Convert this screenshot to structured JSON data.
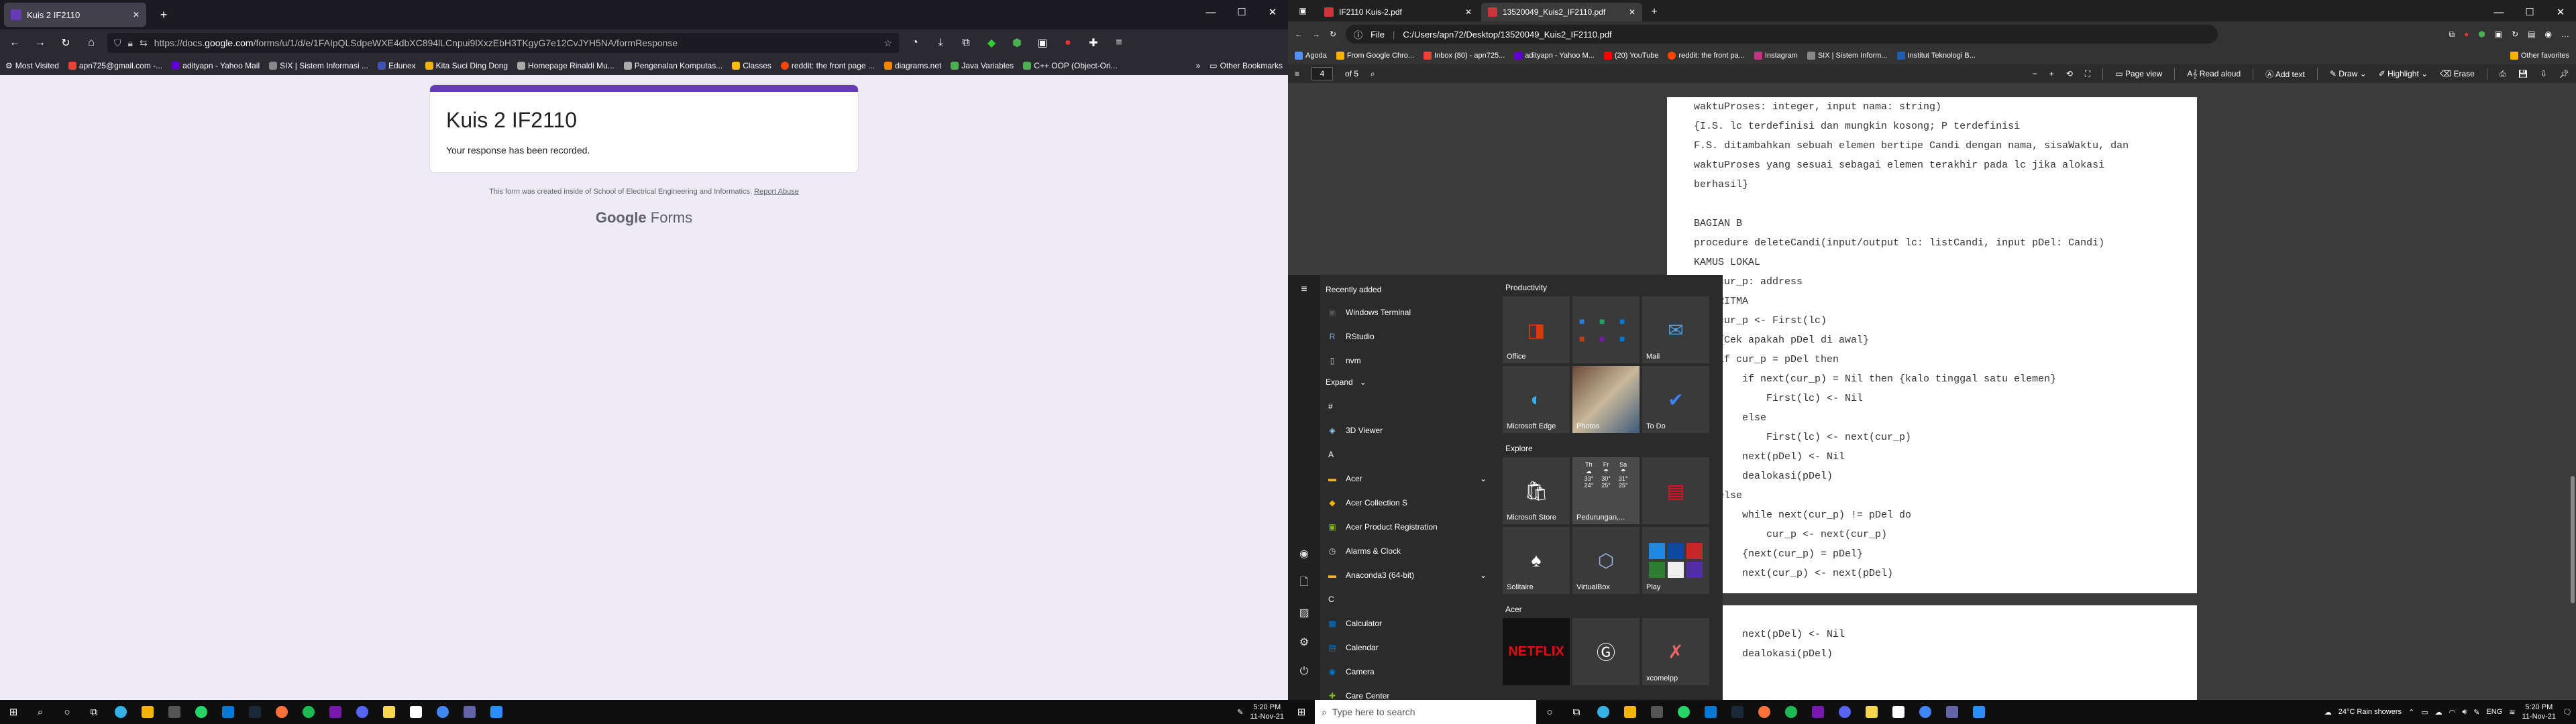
{
  "firefox": {
    "tab_title": "Kuis 2 IF2110",
    "url_prefix": "https://docs.",
    "url_domain": "google.com",
    "url_rest": "/forms/u/1/d/e/1FAIpQLSdpeWXE4dbXC894lLCnpui9lXxzEbH3TKgyG7e12CvJYH5NA/formResponse",
    "bookmarks": [
      "Most Visited",
      "apn725@gmail.com -...",
      "adityapn - Yahoo Mail",
      "SIX | Sistem Informasi ...",
      "Edunex",
      "Kita Suci Ding Dong",
      "Homepage Rinaldi Mu...",
      "Pengenalan Komputas...",
      "Classes",
      "reddit: the front page ...",
      "diagrams.net",
      "Java Variables",
      "C++ OOP (Object-Ori..."
    ],
    "other_bookmarks": "Other Bookmarks",
    "colors": {
      "accent": "#673ab7",
      "page_bg": "#efeaf7"
    }
  },
  "form": {
    "title": "Kuis 2 IF2110",
    "message": "Your response has been recorded.",
    "footer_text": "This form was created inside of School of Electrical Engineering and Informatics.",
    "footer_link": "Report Abuse",
    "brand_google": "Google",
    "brand_forms": "Forms"
  },
  "edge": {
    "tabs": [
      "IF2110 Kuis-2.pdf",
      "13520049_Kuis2_IF2110.pdf"
    ],
    "file_label": "File",
    "url": "C:/Users/apn72/Desktop/13520049_Kuis2_IF2110.pdf",
    "bookmarks": [
      "Agoda",
      "From Google Chro...",
      "Inbox (80) - apn725...",
      "adityapn - Yahoo M...",
      "(20) YouTube",
      "reddit: the front pa...",
      "Instagram",
      "SIX | Sistem Inform...",
      "Institut Teknologi B..."
    ],
    "other_favorites": "Other favorites"
  },
  "pdf_toolbar": {
    "page_current": "4",
    "page_total": "of 5",
    "page_view": "Page view",
    "read_aloud": "Read aloud",
    "add_text": "Add text",
    "draw": "Draw",
    "highlight": "Highlight",
    "erase": "Erase"
  },
  "pdf": {
    "page1_lines": [
      "waktuProses: integer, input nama: string)",
      "{I.S. lc terdefinisi dan mungkin kosong; P terdefinisi",
      "F.S. ditambahkan sebuah elemen bertipe Candi dengan nama, sisaWaktu, dan",
      "waktuProses yang sesuai sebagai elemen terakhir pada lc jika alokasi",
      "berhasil}",
      "",
      "BAGIAN B",
      "procedure deleteCandi(input/output lc: listCandi, input pDel: Candi)",
      "KAMUS LOKAL",
      "    cur_p: address",
      "ALGORITMA",
      "    cur_p <- First(lc)",
      "    {Cek apakah pDel di awal}",
      "    if cur_p = pDel then",
      "        if next(cur_p) = Nil then {kalo tinggal satu elemen}",
      "            First(lc) <- Nil",
      "        else",
      "            First(lc) <- next(cur_p)",
      "        next(pDel) <- Nil",
      "        dealokasi(pDel)",
      "    else",
      "        while next(cur_p) != pDel do",
      "            cur_p <- next(cur_p)",
      "        {next(cur_p) = pDel}",
      "        next(cur_p) <- next(pDel)"
    ],
    "page2_lines": [
      "",
      "        next(pDel) <- Nil",
      "        dealokasi(pDel)"
    ]
  },
  "start_menu": {
    "recently_added": "Recently added",
    "recent": [
      "Windows Terminal",
      "RStudio",
      "nvm"
    ],
    "expand": "Expand",
    "apps": [
      {
        "type": "letter",
        "text": "#"
      },
      {
        "type": "app",
        "text": "3D Viewer"
      },
      {
        "type": "letter",
        "text": "A"
      },
      {
        "type": "folder",
        "text": "Acer"
      },
      {
        "type": "app",
        "text": "Acer Collection S"
      },
      {
        "type": "app",
        "text": "Acer Product Registration"
      },
      {
        "type": "app",
        "text": "Alarms & Clock"
      },
      {
        "type": "folder",
        "text": "Anaconda3 (64-bit)"
      },
      {
        "type": "letter",
        "text": "C"
      },
      {
        "type": "app",
        "text": "Calculator"
      },
      {
        "type": "app",
        "text": "Calendar"
      },
      {
        "type": "app",
        "text": "Camera"
      },
      {
        "type": "app",
        "text": "Care Center"
      }
    ],
    "sections": {
      "productivity": "Productivity",
      "explore": "Explore",
      "acer": "Acer"
    },
    "tiles": {
      "office": "Office",
      "mail": "Mail",
      "edge": "Microsoft Edge",
      "photos": "Photos",
      "todo": "To Do",
      "store": "Microsoft Store",
      "weather_city": "Pedurungan,...",
      "weather_days": [
        "Th",
        "Fr",
        "Sa"
      ],
      "weather_hi": [
        "33°",
        "30°",
        "31°"
      ],
      "weather_lo": [
        "24°",
        "25°",
        "25°"
      ],
      "solitaire": "Solitaire",
      "virtualbox": "VirtualBox",
      "play": "Play",
      "netflix": "NETFLIX",
      "xcomelpp": "xcomelpp"
    }
  },
  "taskbar": {
    "search_placeholder": "Type here to search",
    "weather": "24°C  Rain showers",
    "lang": "ENG",
    "time": "5:20 PM",
    "date": "11-Nov-21"
  }
}
